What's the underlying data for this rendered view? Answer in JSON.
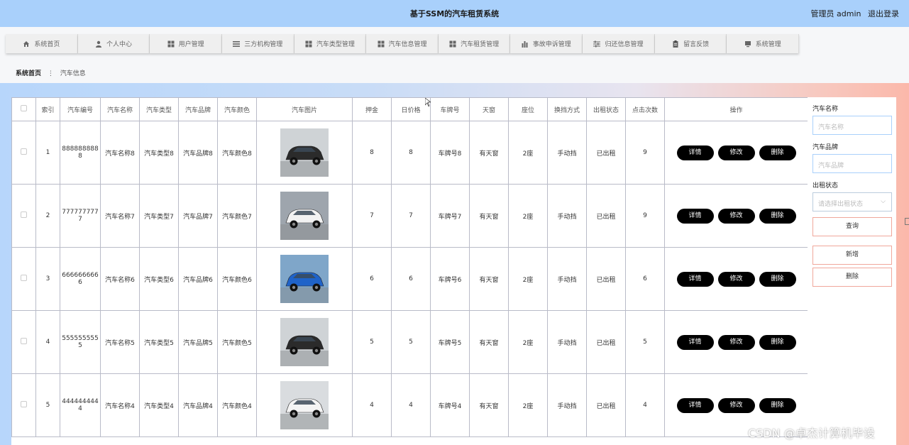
{
  "header": {
    "title": "基于SSM的汽车租赁系统",
    "user_label": "管理员 admin",
    "logout_label": "退出登录"
  },
  "nav": [
    {
      "label": "系统首页",
      "icon": "home-icon"
    },
    {
      "label": "个人中心",
      "icon": "user-icon"
    },
    {
      "label": "用户管理",
      "icon": "grid-icon"
    },
    {
      "label": "三方机构管理",
      "icon": "list-icon"
    },
    {
      "label": "汽车类型管理",
      "icon": "grid-icon"
    },
    {
      "label": "汽车信息管理",
      "icon": "grid-icon"
    },
    {
      "label": "汽车租赁管理",
      "icon": "grid-icon"
    },
    {
      "label": "事故申诉管理",
      "icon": "chart-icon"
    },
    {
      "label": "归还信息管理",
      "icon": "sliders-icon"
    },
    {
      "label": "留言反馈",
      "icon": "clipboard-icon"
    },
    {
      "label": "系统管理",
      "icon": "monitor-icon"
    }
  ],
  "breadcrumb": {
    "home": "系统首页",
    "sep": "⋮",
    "current": "汽车信息"
  },
  "table": {
    "headers": [
      "",
      "索引",
      "汽车编号",
      "汽车名称",
      "汽车类型",
      "汽车品牌",
      "汽车颜色",
      "汽车图片",
      "押金",
      "日价格",
      "车牌号",
      "天窗",
      "座位",
      "换挡方式",
      "出租状态",
      "点击次数",
      "操作"
    ],
    "rows": [
      {
        "index": "1",
        "code": "8888888888",
        "name": "汽车名称8",
        "type": "汽车类型8",
        "brand": "汽车品牌8",
        "color": "汽车颜色8",
        "deposit": "8",
        "price": "8",
        "plate": "车牌号8",
        "sunroof": "有天窗",
        "seats": "2座",
        "gear": "手动挡",
        "status": "已出租",
        "clicks": "9",
        "img_color": "#2b2b2b",
        "img_bg": "#cfd3d6"
      },
      {
        "index": "2",
        "code": "7777777777",
        "name": "汽车名称7",
        "type": "汽车类型7",
        "brand": "汽车品牌7",
        "color": "汽车颜色7",
        "deposit": "7",
        "price": "7",
        "plate": "车牌号7",
        "sunroof": "有天窗",
        "seats": "2座",
        "gear": "手动挡",
        "status": "已出租",
        "clicks": "9",
        "img_color": "#f2f2f2",
        "img_bg": "#9ea5ad"
      },
      {
        "index": "3",
        "code": "6666666666",
        "name": "汽车名称6",
        "type": "汽车类型6",
        "brand": "汽车品牌6",
        "color": "汽车颜色6",
        "deposit": "6",
        "price": "6",
        "plate": "车牌号6",
        "sunroof": "有天窗",
        "seats": "2座",
        "gear": "手动挡",
        "status": "已出租",
        "clicks": "6",
        "img_color": "#1f63c9",
        "img_bg": "#7fa6c9"
      },
      {
        "index": "4",
        "code": "5555555555",
        "name": "汽车名称5",
        "type": "汽车类型5",
        "brand": "汽车品牌5",
        "color": "汽车颜色5",
        "deposit": "5",
        "price": "5",
        "plate": "车牌号5",
        "sunroof": "有天窗",
        "seats": "2座",
        "gear": "手动挡",
        "status": "已出租",
        "clicks": "5",
        "img_color": "#2b2b2b",
        "img_bg": "#cfd3d6"
      },
      {
        "index": "5",
        "code": "4444444444",
        "name": "汽车名称4",
        "type": "汽车类型4",
        "brand": "汽车品牌4",
        "color": "汽车颜色4",
        "deposit": "4",
        "price": "4",
        "plate": "车牌号4",
        "sunroof": "有天窗",
        "seats": "2座",
        "gear": "手动挡",
        "status": "已出租",
        "clicks": "4",
        "img_color": "#f4f4f4",
        "img_bg": "#d9dcdf"
      }
    ],
    "actions": {
      "detail": "详情",
      "edit": "修改",
      "delete": "删除"
    }
  },
  "filters": {
    "name_label": "汽车名称",
    "name_placeholder": "汽车名称",
    "brand_label": "汽车品牌",
    "brand_placeholder": "汽车品牌",
    "status_label": "出租状态",
    "status_placeholder": "请选择出租状态",
    "search_label": "查询",
    "add_label": "新增",
    "delete_label": "删除"
  },
  "watermark": "CSDN @卓杰计算机毕设",
  "colors": {
    "header_bg": "#a9d0fb",
    "button_bg": "#000000",
    "input_border": "#a9d0fb",
    "btn_border": "#f0a79b"
  }
}
